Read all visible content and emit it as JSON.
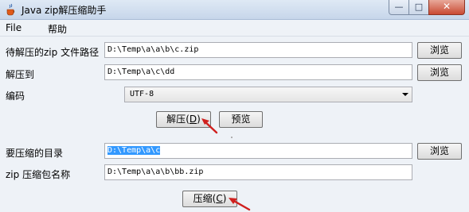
{
  "window": {
    "title": "Java zip解压缩助手",
    "controls": {
      "minimize": "—",
      "maximize": "□",
      "close": "✕"
    }
  },
  "menu": [
    {
      "label": "File"
    },
    {
      "label": "帮助"
    }
  ],
  "unzip": {
    "zip_path_label": "待解压的zip 文件路径",
    "zip_path_value": "D:\\Temp\\a\\a\\b\\c.zip",
    "dest_label": "解压到",
    "dest_value": "D:\\Temp\\a\\c\\dd",
    "encoding_label": "编码",
    "encoding_value": "UTF-8",
    "unzip_button": "解压",
    "unzip_mnemonic": "D",
    "preview_button": "预览"
  },
  "zip": {
    "dir_label": "要压缩的目录",
    "dir_value": "D:\\Temp\\a\\c",
    "name_label": "zip 压缩包名称",
    "name_value": "D:\\Temp\\a\\a\\b\\bb.zip",
    "zip_button": "压缩",
    "zip_mnemonic": "C"
  },
  "browse_label": "浏览",
  "colors": {
    "annotation_arrow": "#d0201e",
    "selection": "#3399ff"
  },
  "icons": {
    "app": "java-cup-icon",
    "annotation": "red-arrow-icon"
  }
}
